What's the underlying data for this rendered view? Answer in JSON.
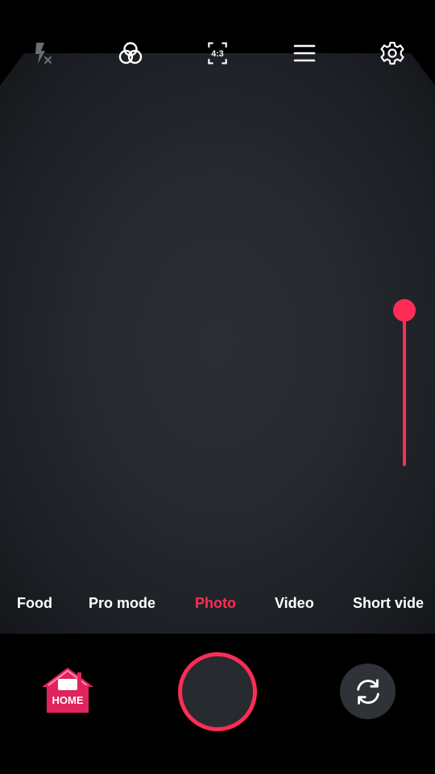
{
  "icons": {
    "flash": "flash-off-icon",
    "filters": "filters-icon",
    "aspect": "aspect-ratio-icon",
    "menu": "menu-icon",
    "settings": "gear-icon",
    "switch_camera": "switch-camera-icon",
    "home": "home-icon"
  },
  "toolbar": {
    "aspect_ratio": "4:3"
  },
  "zoom": {
    "level": 1.0
  },
  "modes": {
    "items": [
      "Food",
      "Pro mode",
      "Photo",
      "Video",
      "Short vide"
    ],
    "selected": "Photo"
  },
  "home_button": {
    "label": "HOME"
  },
  "colors": {
    "accent": "#ff2d55",
    "background": "#000000",
    "text": "#ffffff"
  }
}
